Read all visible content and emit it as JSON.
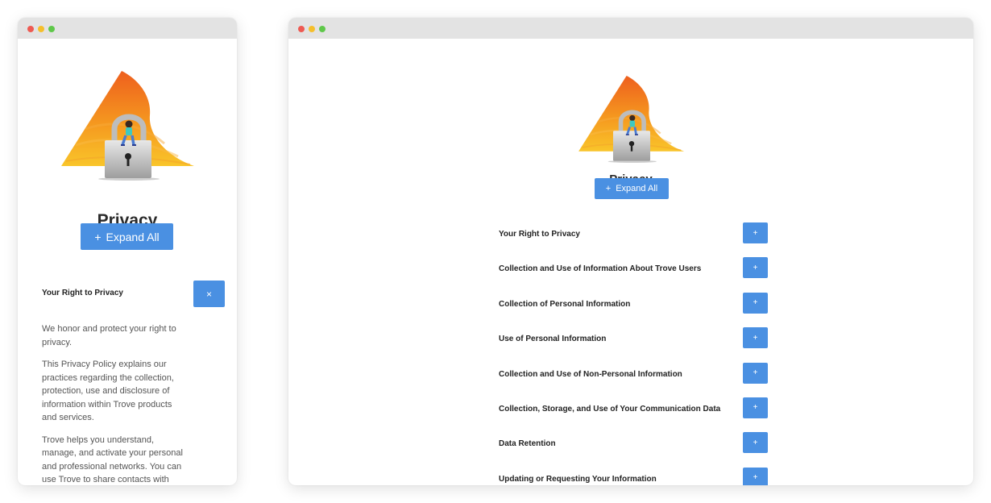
{
  "page": {
    "title": "Privacy",
    "expand_all_icon": "+",
    "expand_all_label": "Expand All"
  },
  "mobile": {
    "section": {
      "label": "Your Right to Privacy",
      "toggle_icon": "×",
      "paragraphs": [
        "We honor and protect your right to privacy.",
        "This Privacy Policy explains our practices regarding the collection, protection, use and disclosure of information within Trove products and services.",
        "Trove helps you understand, manage, and activate your personal and professional networks. You can use Trove to share contacts with"
      ]
    }
  },
  "desktop": {
    "sections": [
      {
        "label": "Your Right to Privacy",
        "toggle_icon": "+"
      },
      {
        "label": "Collection and Use of Information About Trove Users",
        "toggle_icon": "+"
      },
      {
        "label": "Collection of Personal Information",
        "toggle_icon": "+"
      },
      {
        "label": "Use of Personal Information",
        "toggle_icon": "+"
      },
      {
        "label": "Collection and Use of Non-Personal Information",
        "toggle_icon": "+"
      },
      {
        "label": "Collection, Storage, and Use of Your Communication Data",
        "toggle_icon": "+"
      },
      {
        "label": "Data Retention",
        "toggle_icon": "+"
      },
      {
        "label": "Updating or Requesting Your Information",
        "toggle_icon": "+"
      }
    ]
  },
  "icons": {
    "illustration": "privacy-padlock-illustration",
    "window_controls": [
      "close-dot",
      "minimize-dot",
      "maximize-dot"
    ]
  },
  "colors": {
    "accent": "#4a90e2",
    "gradient_top": "#f06a22",
    "gradient_bottom": "#f9c02a"
  }
}
